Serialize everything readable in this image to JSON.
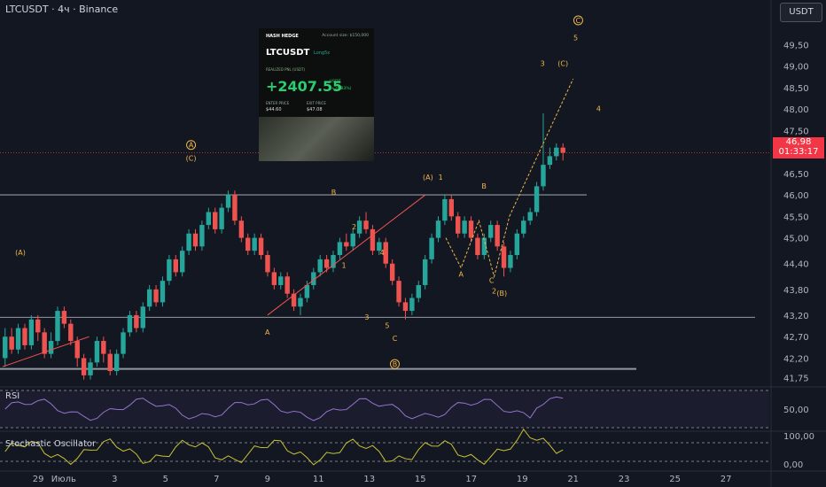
{
  "header": {
    "symbol_line": "LTCUSDT · 4ч · Binance",
    "currency_button": "USDT"
  },
  "last_price": {
    "value": "46,98",
    "countdown": "01:33:17"
  },
  "panes": {
    "rsi_label": "RSI",
    "stoch_label": "Stochastic Oscillator"
  },
  "card": {
    "brand": "HASH HEDGE",
    "account": "Account size: $150,000",
    "symbol": "LTCUSDT",
    "side": "Long5x",
    "realized_label": "REALIZED PNL (USDT)",
    "pnl": "+2407.55",
    "pnl_unit": "USDT",
    "pnl_pct": "(+26.83%)",
    "enter_label": "ENTER PRICE",
    "exit_label": "EXIT PRICE",
    "enter_price": "$44.60",
    "exit_price": "$47.08"
  },
  "colors": {
    "up": "#26a69a",
    "down": "#ef5350",
    "wave": "#f0b64a",
    "rsi": "#9575cd",
    "stoch": "#c9c234"
  },
  "chart_data": {
    "type": "candlestick",
    "y_ticks": [
      "49,50",
      "49,00",
      "48,50",
      "48,00",
      "47,50",
      "46,50",
      "46,00",
      "45,50",
      "45,00",
      "44,40",
      "43,80",
      "43,20",
      "42,70",
      "42,20",
      "41,75"
    ],
    "y_tick_values": [
      49.5,
      49.0,
      48.5,
      48.0,
      47.5,
      46.5,
      46.0,
      45.5,
      45.0,
      44.4,
      43.8,
      43.2,
      42.7,
      42.2,
      41.75
    ],
    "ylim": [
      41.55,
      50.0
    ],
    "x_ticks": [
      "29",
      "Июль",
      "3",
      "5",
      "7",
      "9",
      "11",
      "13",
      "15",
      "17",
      "19",
      "21",
      "23",
      "25",
      "27"
    ],
    "x_tick_days": [
      -1,
      0,
      2,
      4,
      6,
      8,
      10,
      12,
      14,
      16,
      18,
      20,
      22,
      24,
      26
    ],
    "xlim": [
      -2.5,
      27.7
    ],
    "rsi_levels": [
      "100,00",
      "50,00"
    ],
    "stoch_levels": [
      "100,00",
      "0,00"
    ],
    "candles": [
      [
        42.2,
        42.7,
        42.0,
        42.9
      ],
      [
        42.7,
        42.4,
        42.3,
        42.9
      ],
      [
        42.4,
        42.9,
        42.3,
        43.0
      ],
      [
        42.9,
        42.5,
        42.4,
        43.0
      ],
      [
        42.5,
        43.1,
        42.4,
        43.2
      ],
      [
        43.1,
        42.8,
        42.6,
        43.2
      ],
      [
        42.8,
        42.3,
        42.2,
        42.9
      ],
      [
        42.3,
        42.6,
        42.2,
        42.8
      ],
      [
        42.6,
        43.3,
        42.5,
        43.4
      ],
      [
        43.3,
        43.0,
        42.9,
        43.4
      ],
      [
        43.0,
        42.6,
        42.5,
        43.1
      ],
      [
        42.6,
        42.2,
        42.0,
        42.7
      ],
      [
        42.2,
        41.8,
        41.7,
        42.3
      ],
      [
        41.8,
        42.1,
        41.7,
        42.2
      ],
      [
        42.1,
        42.6,
        42.0,
        42.7
      ],
      [
        42.6,
        42.3,
        42.1,
        42.7
      ],
      [
        42.3,
        41.9,
        41.8,
        42.4
      ],
      [
        41.9,
        42.3,
        41.8,
        42.4
      ],
      [
        42.3,
        42.8,
        42.2,
        42.9
      ],
      [
        42.8,
        43.2,
        42.7,
        43.3
      ],
      [
        43.2,
        42.9,
        42.8,
        43.3
      ],
      [
        42.9,
        43.4,
        42.8,
        43.5
      ],
      [
        43.4,
        43.8,
        43.3,
        43.9
      ],
      [
        43.8,
        43.5,
        43.4,
        43.9
      ],
      [
        43.5,
        44.0,
        43.4,
        44.1
      ],
      [
        44.0,
        44.5,
        43.9,
        44.6
      ],
      [
        44.5,
        44.2,
        44.1,
        44.6
      ],
      [
        44.2,
        44.7,
        44.1,
        44.8
      ],
      [
        44.7,
        45.1,
        44.6,
        45.2
      ],
      [
        45.1,
        44.8,
        44.7,
        45.2
      ],
      [
        44.8,
        45.3,
        44.7,
        45.4
      ],
      [
        45.3,
        45.6,
        45.2,
        45.7
      ],
      [
        45.6,
        45.2,
        45.1,
        45.7
      ],
      [
        45.2,
        45.7,
        45.1,
        45.8
      ],
      [
        45.7,
        46.0,
        45.6,
        46.1
      ],
      [
        46.0,
        45.4,
        45.3,
        46.1
      ],
      [
        45.4,
        45.0,
        44.9,
        45.5
      ],
      [
        45.0,
        44.7,
        44.6,
        45.1
      ],
      [
        44.7,
        45.0,
        44.6,
        45.1
      ],
      [
        45.0,
        44.6,
        44.5,
        45.1
      ],
      [
        44.6,
        44.2,
        44.1,
        44.7
      ],
      [
        44.2,
        43.9,
        43.8,
        44.3
      ],
      [
        43.9,
        44.1,
        43.8,
        44.2
      ],
      [
        44.1,
        43.7,
        43.6,
        44.2
      ],
      [
        43.7,
        43.4,
        43.3,
        43.8
      ],
      [
        43.4,
        43.6,
        43.2,
        43.7
      ],
      [
        43.6,
        43.9,
        43.5,
        44.0
      ],
      [
        43.9,
        44.2,
        43.8,
        44.3
      ],
      [
        44.2,
        44.5,
        44.1,
        44.6
      ],
      [
        44.5,
        44.3,
        44.2,
        44.6
      ],
      [
        44.3,
        44.6,
        44.2,
        44.7
      ],
      [
        44.6,
        44.9,
        44.5,
        45.0
      ],
      [
        44.9,
        44.8,
        44.7,
        45.1
      ],
      [
        44.8,
        45.1,
        44.7,
        45.2
      ],
      [
        45.1,
        45.4,
        45.0,
        45.5
      ],
      [
        45.4,
        45.2,
        45.1,
        45.6
      ],
      [
        45.2,
        44.7,
        44.6,
        45.3
      ],
      [
        44.7,
        44.9,
        44.6,
        45.0
      ],
      [
        44.9,
        44.4,
        44.3,
        45.0
      ],
      [
        44.4,
        44.0,
        43.9,
        44.5
      ],
      [
        44.0,
        43.5,
        43.4,
        44.1
      ],
      [
        43.5,
        43.3,
        43.1,
        43.6
      ],
      [
        43.3,
        43.6,
        43.2,
        43.7
      ],
      [
        43.6,
        43.9,
        43.5,
        44.0
      ],
      [
        43.9,
        44.5,
        43.8,
        44.6
      ],
      [
        44.5,
        45.0,
        44.4,
        45.1
      ],
      [
        45.0,
        45.4,
        44.9,
        45.5
      ],
      [
        45.4,
        45.9,
        45.3,
        46.0
      ],
      [
        45.9,
        45.5,
        45.4,
        46.0
      ],
      [
        45.5,
        45.1,
        45.0,
        45.6
      ],
      [
        45.1,
        45.4,
        45.0,
        45.5
      ],
      [
        45.4,
        45.0,
        44.9,
        45.5
      ],
      [
        45.0,
        44.6,
        44.5,
        45.1
      ],
      [
        44.6,
        45.0,
        44.5,
        45.1
      ],
      [
        45.0,
        45.3,
        44.9,
        45.4
      ],
      [
        45.3,
        44.8,
        44.7,
        45.4
      ],
      [
        44.8,
        44.3,
        44.1,
        44.9
      ],
      [
        44.3,
        44.6,
        44.2,
        44.7
      ],
      [
        44.6,
        45.1,
        44.5,
        45.2
      ],
      [
        45.1,
        45.4,
        45.0,
        45.5
      ],
      [
        45.4,
        45.6,
        45.3,
        45.7
      ],
      [
        45.6,
        46.2,
        45.5,
        46.3
      ],
      [
        46.2,
        46.7,
        46.1,
        47.9
      ],
      [
        46.7,
        46.9,
        46.6,
        47.1
      ],
      [
        46.9,
        47.1,
        46.8,
        47.2
      ],
      [
        47.1,
        46.98,
        46.8,
        47.2
      ]
    ],
    "wave_labels": [
      {
        "text": "(A)",
        "day": -1.7,
        "price": 44.6,
        "circled": false
      },
      {
        "text": "A",
        "day": 5.0,
        "price": 47.1,
        "circled": true
      },
      {
        "text": "(C)",
        "day": 5.0,
        "price": 46.8,
        "circled": false
      },
      {
        "text": "A",
        "day": 8.0,
        "price": 42.75,
        "circled": false
      },
      {
        "text": "B",
        "day": 10.6,
        "price": 46.0,
        "circled": false
      },
      {
        "text": "2",
        "day": 11.4,
        "price": 45.2,
        "circled": false
      },
      {
        "text": "1",
        "day": 11.0,
        "price": 44.3,
        "circled": false
      },
      {
        "text": "4",
        "day": 12.5,
        "price": 44.6,
        "circled": false
      },
      {
        "text": "3",
        "day": 11.9,
        "price": 43.1,
        "circled": false
      },
      {
        "text": "5",
        "day": 12.7,
        "price": 42.9,
        "circled": false
      },
      {
        "text": "C",
        "day": 13.0,
        "price": 42.6,
        "circled": false
      },
      {
        "text": "B",
        "day": 13.0,
        "price": 42.0,
        "circled": true
      },
      {
        "text": "(A)",
        "day": 14.3,
        "price": 46.35,
        "circled": false
      },
      {
        "text": "1",
        "day": 14.8,
        "price": 46.35,
        "circled": false
      },
      {
        "text": "B",
        "day": 16.5,
        "price": 46.15,
        "circled": false
      },
      {
        "text": "A",
        "day": 15.6,
        "price": 44.1,
        "circled": false
      },
      {
        "text": "C",
        "day": 16.8,
        "price": 43.95,
        "circled": false
      },
      {
        "text": "2",
        "day": 16.9,
        "price": 43.7,
        "circled": false
      },
      {
        "text": "(B)",
        "day": 17.2,
        "price": 43.65,
        "circled": false
      },
      {
        "text": "3",
        "day": 18.8,
        "price": 49.0,
        "circled": false
      },
      {
        "text": "(C)",
        "day": 19.6,
        "price": 49.0,
        "circled": false
      },
      {
        "text": "4",
        "day": 21.0,
        "price": 47.95,
        "circled": false
      },
      {
        "text": "C",
        "day": 20.2,
        "price": 50.0,
        "circled": true
      },
      {
        "text": "5",
        "day": 20.1,
        "price": 49.6,
        "circled": false
      }
    ]
  }
}
